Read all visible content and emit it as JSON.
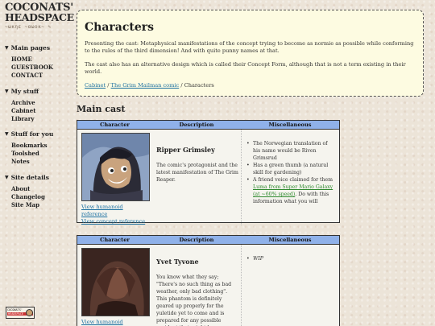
{
  "site": {
    "logo_line1": "COCONATS'",
    "logo_line2": "HEADSPACE",
    "logo_squiggle": "~ωκηε ~αωοκ~ ✎"
  },
  "sidebar": {
    "sections": [
      {
        "title": "Main pages",
        "items": [
          "HOME",
          "GUESTBOOK",
          "CONTACT"
        ]
      },
      {
        "title": "My stuff",
        "items": [
          "Archive",
          "Cabinet",
          "Library"
        ]
      },
      {
        "title": "Stuff for you",
        "items": [
          "Bookmarks",
          "Toolshed",
          "Notes"
        ]
      },
      {
        "title": "Site details",
        "items": [
          "About",
          "Changelog",
          "Site Map"
        ]
      }
    ],
    "badge_line1": "COCONATS'",
    "badge_line2": "HEADSPACE"
  },
  "intro": {
    "title": "Characters",
    "para1": "Presenting the cast: Metaphysical manifestations of the concept trying to become as normie as possible while conforming to the rules of the third dimension! And with quite punny names at that.",
    "para2": "The cast also has an alternative design which is called their Concept Form, although that is not a term existing in their world.",
    "breadcrumb": [
      {
        "label": "Cabinet",
        "link": true
      },
      {
        "label": "The Grim Mailman comic",
        "link": true
      },
      {
        "label": "Characters",
        "link": false
      }
    ]
  },
  "main_cast_heading": "Main cast",
  "table_headers": [
    "Character",
    "Description",
    "Miscellaneous"
  ],
  "characters": [
    {
      "name": "Ripper Grimsley",
      "description": "The comic's protagonist and the latest manifestation of The Grim Reaper.",
      "view_humanoid": "View humanoid reference",
      "view_concept": "View concept reference",
      "misc": [
        "The Norwegian translation of his name would be Riven Grimsrud",
        "Has a green thumb (a natural skill for gardening)"
      ],
      "misc_link_prefix": "A friend voice claimed for them ",
      "misc_link": "Luma from Super Mario Galaxy (at ~60% speed)",
      "misc_link_suffix": ". Do with this information what you will"
    },
    {
      "name": "Yvet Tyvone",
      "description": "You know what they say; \"There's no such thing as bad weather, only bad clothing\". This phantom is definitely geared up properly for the yuletide yet to come and is prepared for any possible accident that might happen on the way of",
      "view_humanoid": "View humanoid reference",
      "misc": [
        "WIP"
      ]
    }
  ],
  "colors": {
    "header_bg": "#8fb1e9",
    "intro_bg": "#fdfbe1",
    "link": "#1a6fa0",
    "link_green": "#2f8a2f"
  }
}
